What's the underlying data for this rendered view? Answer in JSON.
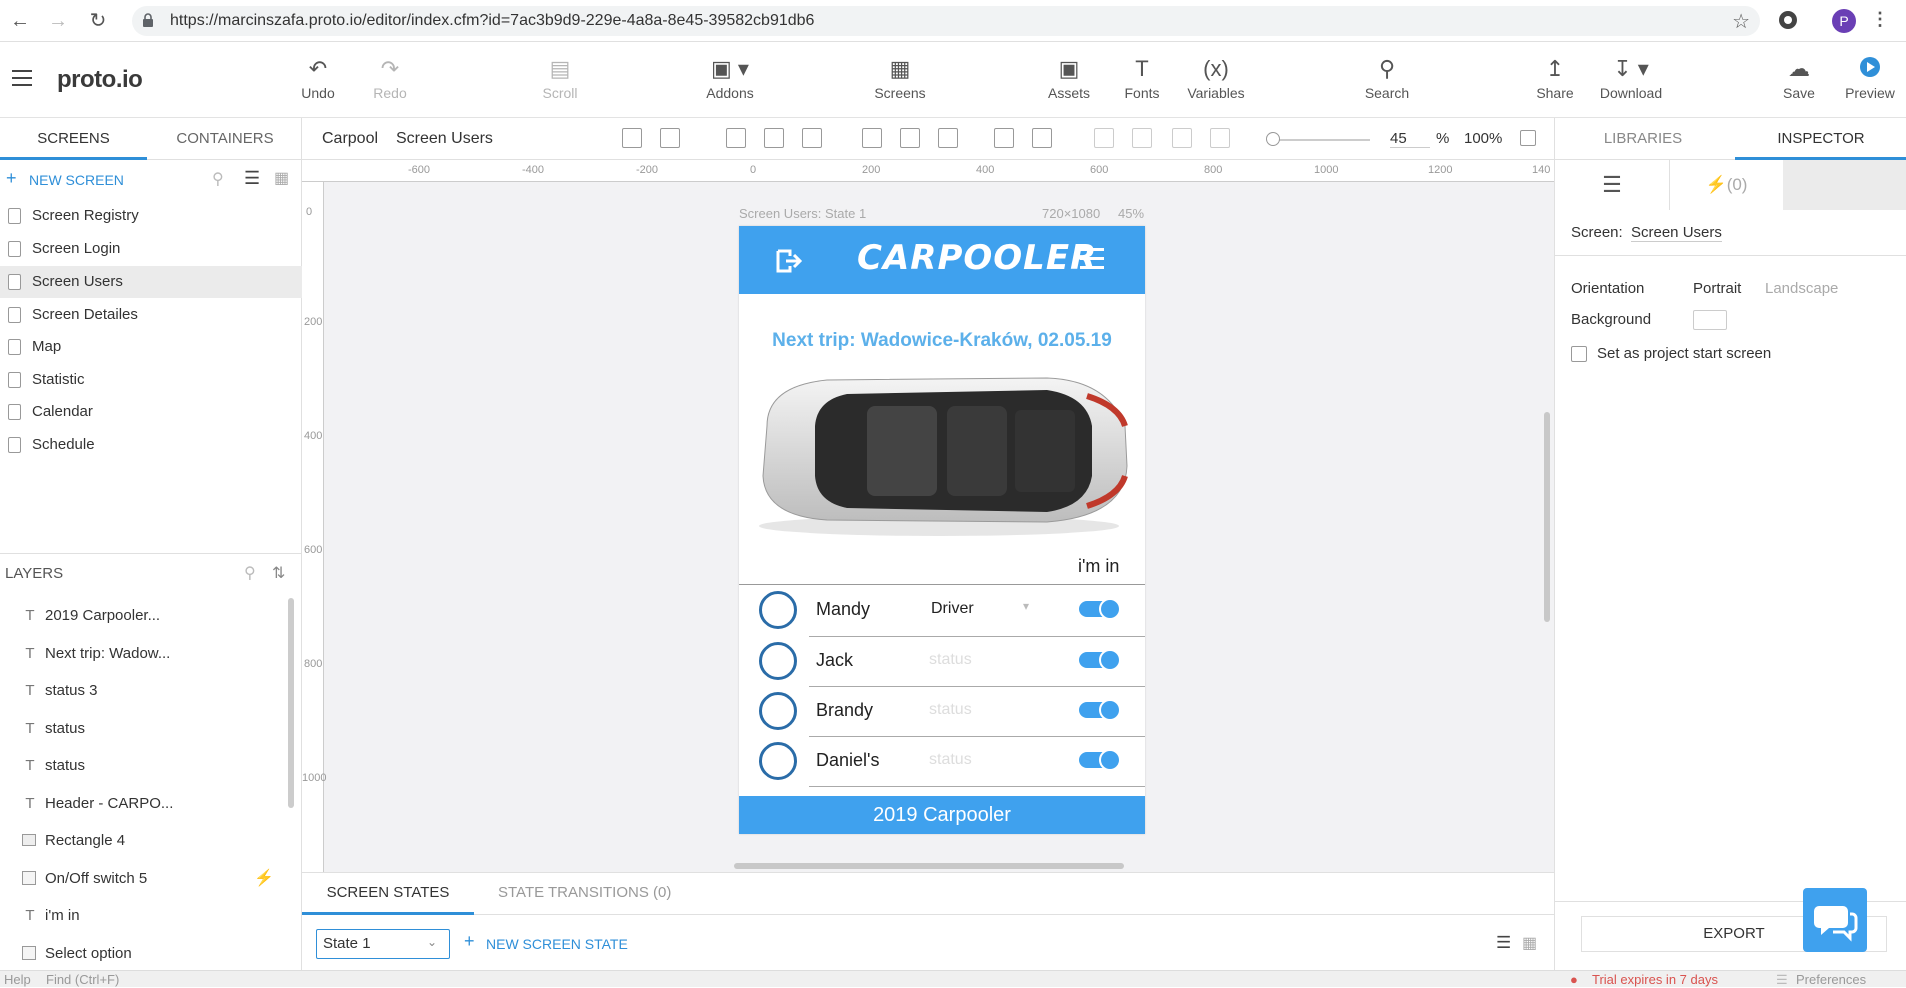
{
  "browser": {
    "url": "https://marcinszafa.proto.io/editor/index.cfm?id=7ac3b9d9-229e-4a8a-8e45-39582cb91db6",
    "profile_initial": "P"
  },
  "app": {
    "logo": "proto.io",
    "toolbar": {
      "undo": "Undo",
      "redo": "Redo",
      "scroll": "Scroll",
      "addons": "Addons",
      "screens": "Screens",
      "assets": "Assets",
      "fonts": "Fonts",
      "variables": "Variables",
      "variables_icon": "(x)",
      "search": "Search",
      "share": "Share",
      "download": "Download",
      "save": "Save",
      "preview": "Preview"
    }
  },
  "left_panel": {
    "tabs": [
      "SCREENS",
      "CONTAINERS"
    ],
    "new_screen": "NEW SCREEN",
    "screens": [
      "Screen Registry",
      "Screen Login",
      "Screen Users",
      "Screen Detailes",
      "Map",
      "Statistic",
      "Calendar",
      "Schedule"
    ],
    "selected_screen": "Screen Users",
    "layers_title": "LAYERS",
    "layers": [
      {
        "icon": "T",
        "label": "2019 Carpooler..."
      },
      {
        "icon": "T",
        "label": "Next trip: Wadow..."
      },
      {
        "icon": "T",
        "label": "status 3"
      },
      {
        "icon": "T",
        "label": "status"
      },
      {
        "icon": "T",
        "label": "status"
      },
      {
        "icon": "T",
        "label": "Header - CARPO..."
      },
      {
        "icon": "rect",
        "label": "Rectangle 4"
      },
      {
        "icon": "component",
        "label": "On/Off switch 5"
      },
      {
        "icon": "T",
        "label": "i'm in"
      },
      {
        "icon": "component",
        "label": "Select option"
      }
    ]
  },
  "canvas_header": {
    "breadcrumb_project": "Carpool",
    "breadcrumb_screen": "Screen Users",
    "zoom_value": "45",
    "zoom_unit": "%",
    "zoom_100": "100%"
  },
  "ruler": {
    "top": [
      "-600",
      "-400",
      "-200",
      "0",
      "200",
      "400",
      "600",
      "800",
      "1000",
      "1200",
      "140"
    ],
    "left": [
      "0",
      "200",
      "400",
      "600",
      "800",
      "1000"
    ]
  },
  "phone": {
    "caption_left": "Screen Users: State 1",
    "caption_size": "720×1080",
    "caption_zoom": "45%",
    "brand": "CARPOOLER",
    "next_trip": "Next trip: Wadowice-Kraków, 02.05.19",
    "im_in": "i'm in",
    "users": [
      {
        "name": "Mandy",
        "status": "Driver",
        "filled": true,
        "switch_on": true
      },
      {
        "name": "Jack",
        "status": "status",
        "filled": false,
        "switch_on": true
      },
      {
        "name": "Brandy",
        "status": "status",
        "filled": false,
        "switch_on": true
      },
      {
        "name": "Daniel's",
        "status": "status",
        "filled": false,
        "switch_on": true
      }
    ],
    "footer": "2019 Carpooler"
  },
  "states_panel": {
    "tabs": [
      "SCREEN STATES",
      "STATE TRANSITIONS (0)"
    ],
    "state_select": "State 1",
    "new_state": "NEW SCREEN STATE"
  },
  "right_panel": {
    "tabs": [
      "LIBRARIES",
      "INSPECTOR"
    ],
    "interactions_count": "(0)",
    "screen_label": "Screen:",
    "screen_name": "Screen Users",
    "orientation_label": "Orientation",
    "portrait": "Portrait",
    "landscape": "Landscape",
    "background_label": "Background",
    "start_screen_label": "Set as project start screen",
    "start_screen_checked": false,
    "export": "EXPORT"
  },
  "status_bar": {
    "help": "Help",
    "find": "Find (Ctrl+F)",
    "trial": "Trial expires in 7 days",
    "preferences": "Preferences"
  },
  "colors": {
    "accent": "#2f8fd8",
    "phone_blue": "#3fa1ee",
    "avatar_ring": "#2a6ca8"
  }
}
